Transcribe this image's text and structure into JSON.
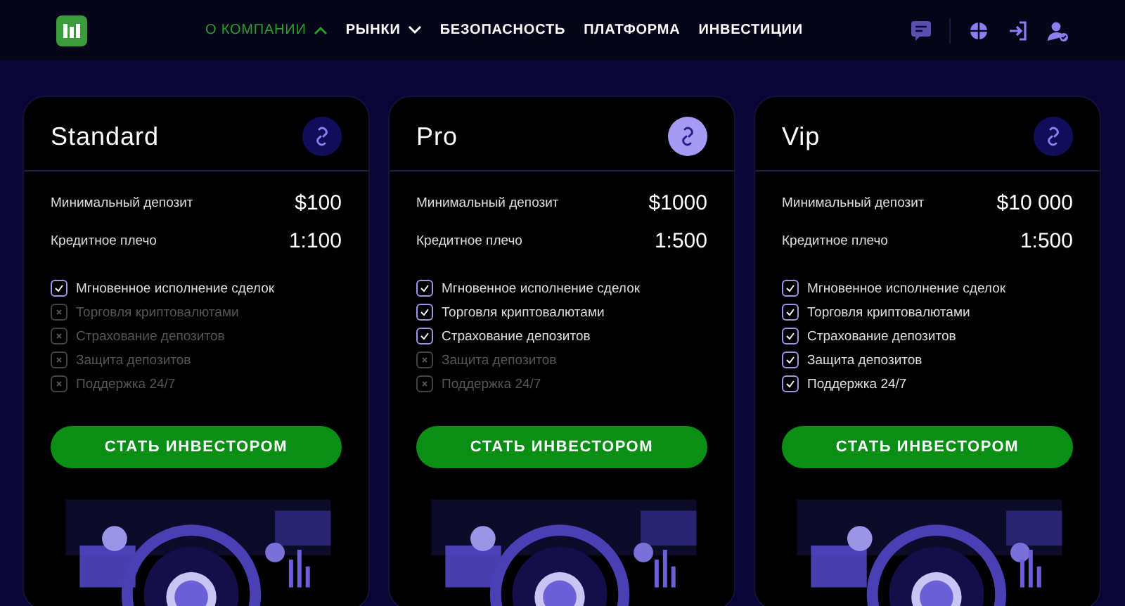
{
  "header": {
    "nav": [
      {
        "label": "О КОМПАНИИ",
        "kind": "dropdown",
        "selected": true,
        "expanded": true
      },
      {
        "label": "РЫНКИ",
        "kind": "dropdown",
        "selected": false,
        "expanded": false
      },
      {
        "label": "БЕЗОПАСНОСТЬ",
        "kind": "link",
        "selected": false
      },
      {
        "label": "ПЛАТФОРМА",
        "kind": "link",
        "selected": false
      },
      {
        "label": "ИНВЕСТИЦИИ",
        "kind": "link",
        "selected": false
      }
    ]
  },
  "plans": [
    {
      "name": "Standard",
      "selected": false,
      "deposit_label": "Минимальный депозит",
      "deposit": "$100",
      "leverage_label": "Кредитное плечо",
      "leverage": "1:100",
      "features": [
        {
          "label": "Мгновенное исполнение сделок",
          "checked": true
        },
        {
          "label": "Торговля криптовалютами",
          "checked": false
        },
        {
          "label": "Страхование депозитов",
          "checked": false
        },
        {
          "label": "Защита депозитов",
          "checked": false
        },
        {
          "label": "Поддержка 24/7",
          "checked": false
        }
      ],
      "button": "СТАТЬ ИНВЕСТОРОМ"
    },
    {
      "name": "Pro",
      "selected": true,
      "deposit_label": "Минимальный депозит",
      "deposit": "$1000",
      "leverage_label": "Кредитное плечо",
      "leverage": "1:500",
      "features": [
        {
          "label": "Мгновенное исполнение сделок",
          "checked": true
        },
        {
          "label": "Торговля криптовалютами",
          "checked": true
        },
        {
          "label": "Страхование депозитов",
          "checked": true
        },
        {
          "label": "Защита депозитов",
          "checked": false
        },
        {
          "label": "Поддержка 24/7",
          "checked": false
        }
      ],
      "button": "СТАТЬ ИНВЕСТОРОМ"
    },
    {
      "name": "Vip",
      "selected": false,
      "deposit_label": "Минимальный депозит",
      "deposit": "$10 000",
      "leverage_label": "Кредитное плечо",
      "leverage": "1:500",
      "features": [
        {
          "label": "Мгновенное исполнение сделок",
          "checked": true
        },
        {
          "label": "Торговля криптовалютами",
          "checked": true
        },
        {
          "label": "Страхование депозитов",
          "checked": true
        },
        {
          "label": "Защита депозитов",
          "checked": true
        },
        {
          "label": "Поддержка 24/7",
          "checked": true
        }
      ],
      "button": "СТАТЬ ИНВЕСТОРОМ"
    }
  ]
}
